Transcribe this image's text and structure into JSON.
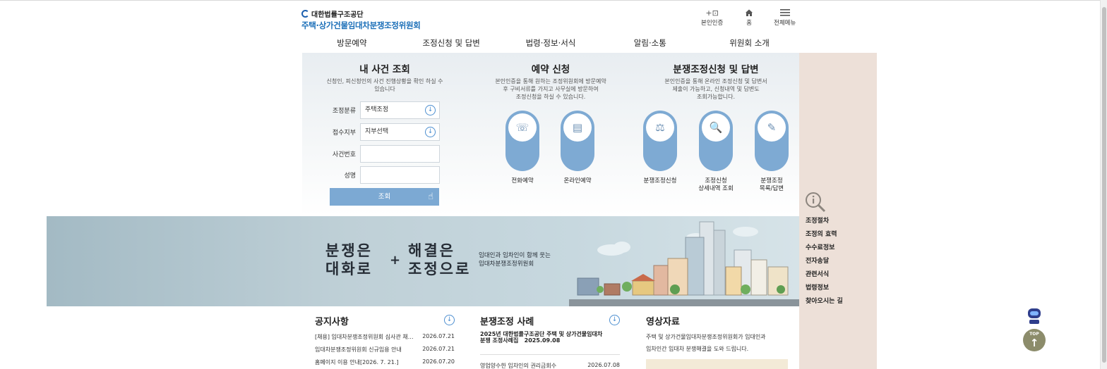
{
  "header": {
    "org_name": "대한법률구조공단",
    "site_name": "주택·상가건물임대차분쟁조정위원회",
    "util": [
      {
        "icon": "login-icon",
        "label": "본인인증"
      },
      {
        "icon": "home-icon",
        "label": "홈"
      },
      {
        "icon": "menu-icon",
        "label": "전체메뉴"
      }
    ]
  },
  "gnb": [
    "방문예약",
    "조정신청 및 답변",
    "법령·정보·서식",
    "알림·소통",
    "위원회 소개"
  ],
  "case_lookup": {
    "title": "내 사건 조회",
    "desc_line1": "신청인, 피신청인의 사건 진행상황을 확인 하실 수",
    "desc_line2": "있습니다",
    "fields": [
      {
        "label": "조정분류",
        "value": "주택조정",
        "type": "select"
      },
      {
        "label": "접수지부",
        "value": "지부선택",
        "type": "select"
      },
      {
        "label": "사건번호",
        "value": "",
        "type": "text"
      },
      {
        "label": "성명",
        "value": "",
        "type": "text"
      }
    ],
    "button": "조회"
  },
  "reservation": {
    "title": "예약 신청",
    "desc_line1": "본인인증을 통해 원하는 조정위원회에 방문예약",
    "desc_line2": "후 구비서류를 가지고 사무실에 방문하여",
    "desc_line3": "조정신청을 하실 수 있습니다.",
    "items": [
      {
        "label": "전화예약",
        "icon": "phone-consult-icon"
      },
      {
        "label": "온라인예약",
        "icon": "online-reservation-icon"
      }
    ]
  },
  "application": {
    "title": "분쟁조정신청 및 답변",
    "desc_line1": "본인인증을 통해 온라인 조정신청 및 답변서",
    "desc_line2": "제출이 가능하고, 신청내역 및 답변도",
    "desc_line3": "조회가능합니다.",
    "items": [
      {
        "label1": "분쟁조정신청",
        "label2": "",
        "icon": "document-scale-icon"
      },
      {
        "label1": "조정신청",
        "label2": "상세내역 조회",
        "icon": "document-search-icon"
      },
      {
        "label1": "분쟁조정",
        "label2": "목록/답변",
        "icon": "chat-answer-icon"
      }
    ]
  },
  "side_menu": [
    "조정절차",
    "조정의 효력",
    "수수료정보",
    "전자송달",
    "관련서식",
    "법령정보",
    "찾아오시는 길"
  ],
  "banner": {
    "slogan_a1": "분쟁은",
    "slogan_a2": "대화로",
    "slogan_b1": "해결은",
    "slogan_b2": "조정으로",
    "plus": "+",
    "sub1": "임대인과 임차인이 함께 웃는",
    "sub2": "임대차분쟁조정위원회"
  },
  "notice": {
    "title": "공지사항",
    "rows": [
      {
        "text": "[채용] 임대차분쟁조정위원회 심사관 채용 공고",
        "date": "2026.07.21"
      },
      {
        "text": "임대차분쟁조정위원회 신규임용 안내",
        "date": "2026.07.21"
      },
      {
        "text": "홈페이지 이용 안내[2026. 7. 21.]",
        "date": "2026.07.20"
      }
    ]
  },
  "cases": {
    "title": "분쟁조정 사례",
    "headline1": "2025년 대한법률구조공단 주택 및 상가건물임대차",
    "headline2": "분쟁 조정사례집",
    "headline_date": "2025.09.08",
    "row_text": "영업양수한 임차인의 권리금회수",
    "row_date": "2026.07.08"
  },
  "video": {
    "title": "영상자료",
    "desc1": "주택 및 상가건물임대차분쟁조정위원회가 임대인과",
    "desc2": "임차인간 임대차 분쟁해결을 도와 드립니다."
  },
  "floating": {
    "top_label": "TOP"
  },
  "colors": {
    "accent": "#7eaad3",
    "brand": "#1b6fb8",
    "side_bg": "#ede0d8",
    "banner_bg": "#b8ccd4"
  }
}
